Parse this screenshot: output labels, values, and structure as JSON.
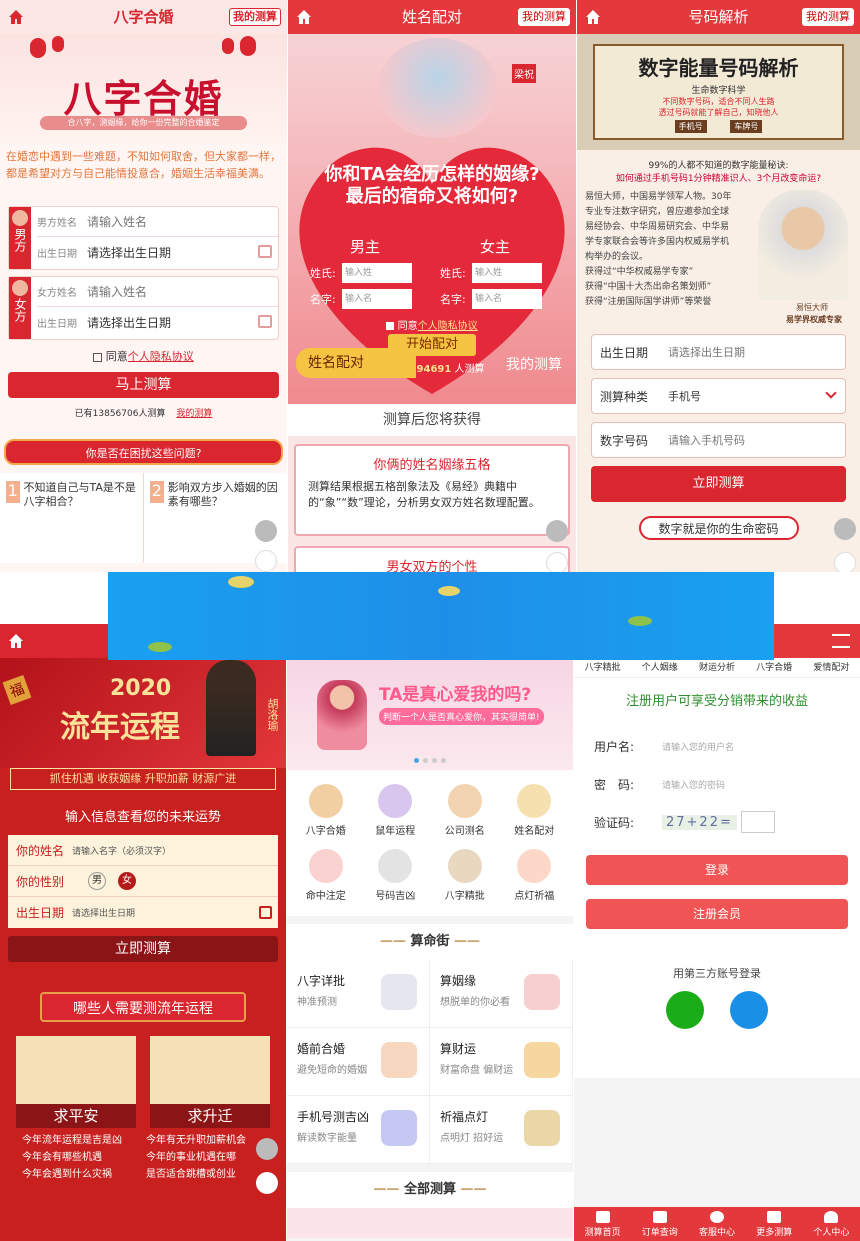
{
  "p1": {
    "header": "八字合婚",
    "my_btn": "我的测算",
    "banner_title": "八字合婚",
    "banner_sub": "合八字，测姻缘，给你一份完整的合婚鉴定",
    "intro": "在婚恋中遇到一些难题，不知如何取舍，但大家都一样，都是希望对方与自己能情投意合，婚姻生活幸福美满。",
    "male_tag": "男方",
    "female_tag": "女方",
    "male_name_label": "男方姓名",
    "male_name_ph": "请输入姓名",
    "female_name_label": "女方姓名",
    "female_name_ph": "请输入姓名",
    "date_label": "出生日期",
    "date_ph": "请选择出生日期",
    "agree": "同意",
    "privacy": "个人隐私协议",
    "submit": "马上测算",
    "count_prefix": "已有",
    "count": "13856706",
    "count_suffix": "人测算",
    "my_link": "我的测算",
    "question": "你是否在困扰这些问题?",
    "q1_no": "1",
    "q1": "不知道自己与TA是不是八字相合？",
    "q2_no": "2",
    "q2": "影响双方步入婚姻的因素有哪些？"
  },
  "p2": {
    "header": "姓名配对",
    "my_btn": "我的测算",
    "couple_tag": "梁祝",
    "headline1": "你和TA会经历怎样的姻缘?",
    "headline2": "最后的宿命又将如何?",
    "male": "男主",
    "female": "女主",
    "surname": "姓氏:",
    "surname_ph": "输入姓",
    "givenname": "名字:",
    "givenname_ph": "输入名",
    "agree": "同意",
    "privacy": "个人隐私协议",
    "start": "开始配对",
    "count_prefix": "已有",
    "count": "1594691",
    "count_suffix": "人测算",
    "tab_left": "姓名配对",
    "tab_right": "我的测算",
    "gain_title": "测算后您将获得",
    "card1_title": "你俩的姓名姻缘五格",
    "card1_text": "测算结果根据五格剖象法及《易经》典籍中的“象”“数”理论，分析男女双方姓名数理配置。",
    "card2_title": "男女双方的个性"
  },
  "p3": {
    "header": "号码解析",
    "my_btn": "我的测算",
    "banner_title": "数字能量号码解析",
    "banner_sub": "生命数字科学",
    "banner_line1": "不同数字号码，适合不同人生路",
    "banner_line2": "透过号码就能了解自己，知晓他人",
    "stamp1": "手机号",
    "stamp2": "车牌号",
    "tip1": "99%的人都不知道的数字能量秘诀:",
    "tip2": "如何通过手机号码1分钟精准识人、3个月改变命运?",
    "bio": [
      "易恒大师，中国易学领军人物。30年专业专注数字研究，曾应邀参加全球易经协会、中华周易研究会、中华易学专家联合会等许多国内权威易学机构举办的会议。",
      "获得过“中华权威易学专家”",
      "获得“中国十大杰出命名策划师”",
      "获得“注册国际国学讲师”等荣誉"
    ],
    "master_name": "易恒大师",
    "master_title": "易学界权威专家",
    "f1_label": "出生日期",
    "f1_ph": "请选择出生日期",
    "f2_label": "测算种类",
    "f2_val": "手机号",
    "f3_label": "数字号码",
    "f3_ph": "请输入手机号码",
    "submit": "立即测算",
    "footer_title": "数字就是你的生命密码"
  },
  "p4": {
    "banner_year": "2020",
    "banner_title": "流年运程",
    "banner_name": "胡洛瑜",
    "banner_tags": "抓住机遇 收获姻缘 升职加薪 财源广进",
    "fu": "福",
    "form_title": "输入信息查看您的未来运势",
    "name_label": "你的姓名",
    "name_ph": "请输入名字（必须汉字）",
    "gender_label": "你的性别",
    "male": "男",
    "female": "女",
    "date_label": "出生日期",
    "date_ph": "请选择出生日期",
    "submit": "立即测算",
    "who_title": "哪些人需要测流年运程",
    "card1": "求平安",
    "card2": "求升迁",
    "lines_left": [
      "今年流年运程是吉是凶",
      "今年会有哪些机遇",
      "今年会遇到什么灾祸"
    ],
    "lines_right": [
      "今年有无升职加薪机会",
      "今年的事业机遇在哪",
      "是否适合跳槽或创业"
    ]
  },
  "p5": {
    "banner_title": "TA是真心爱我的吗?",
    "banner_sub": "判断一个人是否真心爱你，其实很简单!",
    "icons": [
      "八字合婚",
      "鼠年运程",
      "公司测名",
      "姓名配对",
      "命中注定",
      "号码吉凶",
      "八字精批",
      "点灯祈福"
    ],
    "street_title": "算命街",
    "services": [
      {
        "t": "八字详批",
        "d": "神准预测"
      },
      {
        "t": "算姻缘",
        "d": "想脱单的你必看"
      },
      {
        "t": "婚前合婚",
        "d": "避免短命的婚姻"
      },
      {
        "t": "算财运",
        "d": "财富命盘 偏财运"
      },
      {
        "t": "手机号测吉凶",
        "d": "解读数字能量"
      },
      {
        "t": "祈福点灯",
        "d": "点明灯 招好运"
      }
    ],
    "all_title": "全部测算"
  },
  "p6": {
    "nav": [
      "八字精批",
      "个人姻缘",
      "财运分析",
      "八字合婚",
      "爱情配对"
    ],
    "promo": "注册用户可享受分销带来的收益",
    "user_label": "用户名:",
    "user_ph": "请输入您的用户名",
    "pwd_label": "密　码:",
    "pwd_ph": "请输入您的密码",
    "code_label": "验证码:",
    "captcha": "27+22=",
    "login": "登录",
    "register": "注册会员",
    "third": "用第三方账号登录",
    "tabs": [
      "测算首页",
      "订单查询",
      "客服中心",
      "更多测算",
      "个人中心"
    ]
  },
  "colors": {
    "red": "#e4393c",
    "dark_red": "#c81e22",
    "pink": "#fbeaea",
    "gold": "#f6c443",
    "blue": "#1a8fe6"
  },
  "icon_names": [
    "home-icon",
    "calendar-icon",
    "share-icon",
    "scroll-up-icon",
    "wechat-icon",
    "qq-icon",
    "menu-search-icon",
    "chevron-down-icon"
  ]
}
